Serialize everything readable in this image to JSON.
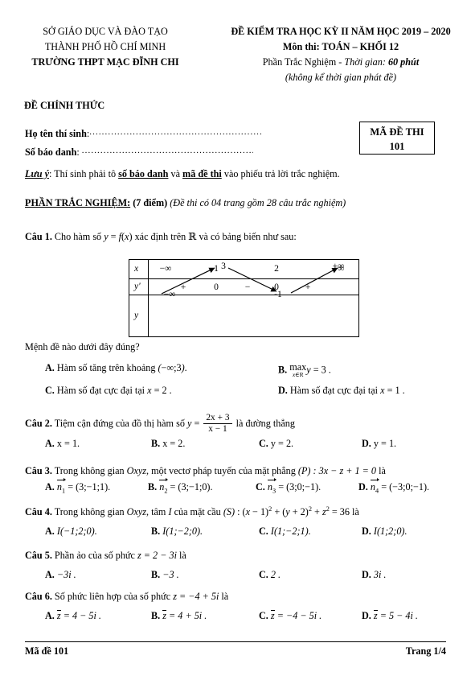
{
  "header": {
    "left_lines": [
      "SỞ GIÁO DỤC VÀ ĐÀO TẠO",
      "THÀNH PHỐ HỒ CHÍ MINH",
      "TRƯỜNG THPT MẠC ĐĨNH CHI"
    ],
    "right_title": "ĐỀ KIỂM TRA HỌC KỲ II NĂM HỌC 2019 – 2020",
    "right_subject": "Môn thi: TOÁN – KHỐI 12",
    "right_part_label": "Phần Trắc Nghiệm - ",
    "right_time_label": "Thời gian: ",
    "right_time_value": "60 phút",
    "right_note": "(không kể thời gian phát đề)",
    "official_label": "ĐỀ CHÍNH THỨC"
  },
  "candidate": {
    "name_label": "Họ tên thí sinh",
    "name_colon": ":",
    "name_leader": "..................................................................",
    "id_label": "Số báo danh",
    "id_colon": ": ",
    "id_leader": ".................................................................",
    "code_box_title": "MÃ ĐỀ THI",
    "code_box_value": "101"
  },
  "note": {
    "prefix": "Lưu ý",
    "colon": ": ",
    "text_1": "Thí sinh phải tô ",
    "em_1": "số báo danh",
    "text_2": " và ",
    "em_2": "mã đề thi",
    "text_3": " vào phiếu trả lời trắc nghiệm."
  },
  "section": {
    "title": "PHẦN TRẮC NGHIỆM:",
    "points": "(7 điểm)",
    "detail": "(Đề thi có 04 trang gồm 28 câu trắc nghiệm)"
  },
  "questions": [
    {
      "number": "Câu 1.",
      "stem_a": "Cho hàm số ",
      "stem_fx": "y = f(x)",
      "stem_b": " xác định trên ",
      "stem_R": "ℝ",
      "stem_c": " và có bảng biến như sau:",
      "sub_prompt": "Mệnh đề nào dưới đây đúng?",
      "options": [
        {
          "letter": "A.",
          "text": "Hàm số tăng trên khoảng (−∞;3)."
        },
        {
          "letter": "B.",
          "text": "max y = 3 ."
        },
        {
          "letter": "C.",
          "text": "Hàm số đạt cực đại tại x = 2 ."
        },
        {
          "letter": "D.",
          "text": "Hàm số đạt cực đại tại x = 1 ."
        }
      ]
    },
    {
      "number": "Câu 2.",
      "stem_a": "Tiệm cận đứng của đồ thị hàm số ",
      "stem_y": "y =",
      "frac_num": "2x + 3",
      "frac_den": "x − 1",
      "stem_b": " là đường thẳng",
      "options": [
        {
          "letter": "A.",
          "text": "x = 1."
        },
        {
          "letter": "B.",
          "text": "x = 2."
        },
        {
          "letter": "C.",
          "text": "y = 2."
        },
        {
          "letter": "D.",
          "text": "y = 1."
        }
      ]
    },
    {
      "number": "Câu 3.",
      "stem_a": "Trong không gian ",
      "stem_oxyz": "Oxyz",
      "stem_b": ", một vectơ pháp tuyến của mặt phẳng ",
      "stem_plane": "(P) : 3x − z + 1 = 0",
      "stem_c": " là",
      "options": [
        {
          "letter": "A.",
          "vec": "n",
          "sub": "1",
          "text": " = (3;−1;1)."
        },
        {
          "letter": "B.",
          "vec": "n",
          "sub": "2",
          "text": " = (3;−1;0)."
        },
        {
          "letter": "C.",
          "vec": "n",
          "sub": "3",
          "text": " = (3;0;−1)."
        },
        {
          "letter": "D.",
          "vec": "n",
          "sub": "4",
          "text": " = (−3;0;−1)."
        }
      ]
    },
    {
      "number": "Câu 4.",
      "stem_a": "Trong không gian ",
      "stem_oxyz": "Oxyz",
      "stem_b": ", tâm ",
      "stem_I": "I",
      "stem_c": " của mặt cầu ",
      "stem_sphere": "(S) : (x − 1)² + (y + 2)² + z² = 36",
      "stem_d": " là",
      "options": [
        {
          "letter": "A.",
          "text": "I(−1;2;0)."
        },
        {
          "letter": "B.",
          "text": "I(1;−2;0)."
        },
        {
          "letter": "C.",
          "text": "I(1;−2;1)."
        },
        {
          "letter": "D.",
          "text": "I(1;2;0)."
        }
      ]
    },
    {
      "number": "Câu 5.",
      "stem_a": "Phần ảo của số phức ",
      "stem_z": "z = 2 − 3i",
      "stem_b": " là",
      "options": [
        {
          "letter": "A.",
          "text": "−3i ."
        },
        {
          "letter": "B.",
          "text": "−3 ."
        },
        {
          "letter": "C.",
          "text": "2 ."
        },
        {
          "letter": "D.",
          "text": "3i ."
        }
      ]
    },
    {
      "number": "Câu 6.",
      "stem_a": "Số phức liên hợp của số phức ",
      "stem_z": "z = −4 + 5i",
      "stem_b": " là",
      "options": [
        {
          "letter": "A.",
          "text": " = 4 − 5i ."
        },
        {
          "letter": "B.",
          "text": " = 4 + 5i ."
        },
        {
          "letter": "C.",
          "text": " = −4 − 5i ."
        },
        {
          "letter": "D.",
          "text": " = 5 − 4i ."
        }
      ]
    }
  ],
  "variation_table": {
    "row_labels": [
      "x",
      "y'",
      "y"
    ],
    "x_values": [
      "−∞",
      "1",
      "2",
      "+∞"
    ],
    "yprime_values": [
      "+",
      "0",
      "−",
      "0",
      "+"
    ],
    "y_values": [
      "−∞",
      "3",
      "-1",
      "+∞"
    ]
  },
  "footer": {
    "left": "Mã đề 101",
    "right": "Trang 1/4"
  }
}
